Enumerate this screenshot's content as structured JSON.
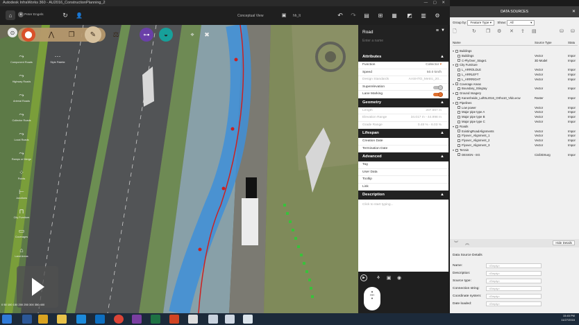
{
  "window": {
    "title": "Autodesk InfraWorks 360 - AU2016_ConstructionPlanning_2"
  },
  "toolbar": {
    "user_name": "Peter Engels",
    "view_name": "Conceptual View",
    "file_name": "hh_lt"
  },
  "left_tools": [
    "Component Roads",
    "Style Palette",
    "Highway Roads",
    "Arterial Roads",
    "Collector Roads",
    "Local Roads",
    "Ramps or Merge",
    "Points",
    "Junctions",
    "City Furniture",
    "Coverages",
    "Land Areas"
  ],
  "map": {
    "scale_text": "0   50   100   150   200   250   300   350   400"
  },
  "road_panel": {
    "title": "Road",
    "name_placeholder": "Enter a name",
    "attributes_label": "Attributes",
    "function_label": "Function",
    "function_value": "Collector",
    "speed_label": "Speed",
    "speed_value": "50.0 km/h",
    "design_label": "Design Standards",
    "design_value": "AASHTO_Metric_20...",
    "superelevation_label": "Superelevation",
    "lane_marking_label": "Lane Marking",
    "geometry_label": "Geometry",
    "length_label": "Length",
    "length_value": "207.567 m",
    "elevation_label": "Elevation Range",
    "elevation_value": "34.017 m - 44.998 m",
    "grade_label": "Grade Range",
    "grade_value": "0.48 % - 6.03 %",
    "lifespan_label": "Lifespan",
    "creation_label": "Creation Date",
    "termination_label": "Termination Date",
    "advanced_label": "Advanced",
    "tag_label": "Tag",
    "user_data_label": "User Data",
    "tooltip_label": "Tooltip",
    "link_label": "Link",
    "description_label": "Description",
    "description_placeholder": "Click to start typing..."
  },
  "data_sources": {
    "title": "DATA SOURCES",
    "group_by_label": "Group by:",
    "group_by_value": "Feature Type",
    "show_label": "Show:",
    "show_value": "All",
    "col_name": "Name",
    "col_source_type": "Source Type",
    "col_status": "Statu",
    "tree": [
      {
        "label": "Buildings",
        "type": "",
        "status": "",
        "level": 0
      },
      {
        "label": "Buildings",
        "type": "Vector",
        "status": "Impor",
        "level": 1
      },
      {
        "label": "C-PlyOver_Stage1",
        "type": "3D Model",
        "status": "Impor",
        "level": 1
      },
      {
        "label": "City Furniture",
        "type": "",
        "status": "",
        "level": 0
      },
      {
        "label": "L_ARROLDLE",
        "type": "Vector",
        "status": "Impor",
        "level": 1
      },
      {
        "label": "L_ARRLEFT",
        "type": "Vector",
        "status": "Impor",
        "level": 1
      },
      {
        "label": "L_ARRRIGHT",
        "type": "Vector",
        "status": "Impor",
        "level": 1
      },
      {
        "label": "Coverage Areas",
        "type": "",
        "status": "",
        "level": 0
      },
      {
        "label": "Boundary_Stingray",
        "type": "Vector",
        "status": "Impor",
        "level": 1
      },
      {
        "label": "Ground Imagery",
        "type": "",
        "status": "",
        "level": 0
      },
      {
        "label": "Kanenheide_Luft0L2016_Ortho10_Vldo.ecw",
        "type": "Raster",
        "status": "Impor",
        "level": 1
      },
      {
        "label": "Pipelines",
        "type": "",
        "status": "",
        "level": 0
      },
      {
        "label": "Low power",
        "type": "Vector",
        "status": "Impor",
        "level": 1
      },
      {
        "label": "Major pipe type A",
        "type": "Vector",
        "status": "Impor",
        "level": 1
      },
      {
        "label": "Major pipe type B",
        "type": "Vector",
        "status": "Impor",
        "level": 1
      },
      {
        "label": "Major pipe type C",
        "type": "Vector",
        "status": "Impor",
        "level": 1
      },
      {
        "label": "Roads",
        "type": "",
        "status": "",
        "level": 0
      },
      {
        "label": "ExistingRoadAlignments",
        "type": "Vector",
        "status": "Impor",
        "level": 1
      },
      {
        "label": "Flyover_Alignment_1",
        "type": "Vector",
        "status": "Impor",
        "level": 1
      },
      {
        "label": "Flyover_Alignment_2",
        "type": "Vector",
        "status": "Impor",
        "level": 1
      },
      {
        "label": "Flyover_Alignment_3",
        "type": "Vector",
        "status": "Impor",
        "level": 1
      },
      {
        "label": "Terrain",
        "type": "",
        "status": "",
        "level": 0
      },
      {
        "label": "DESIGN - EG",
        "type": "Civil3DSurg",
        "status": "Impor",
        "level": 1
      }
    ],
    "hide_details_label": "Hide Details",
    "details_title": "Data Source Details",
    "details": [
      {
        "label": "Name:",
        "value": "<Empty>"
      },
      {
        "label": "Description:",
        "value": "<Empty>"
      },
      {
        "label": "Source type:",
        "value": "<Empty>"
      },
      {
        "label": "Connection string:",
        "value": "<Empty>"
      },
      {
        "label": "Coordinate system:",
        "value": "<Empty>"
      },
      {
        "label": "Date loaded:",
        "value": "<Empty>"
      }
    ]
  },
  "taskbar": {
    "time": "15:45 PM",
    "date": "11/27/2016"
  },
  "compass": {
    "label": "HH"
  }
}
